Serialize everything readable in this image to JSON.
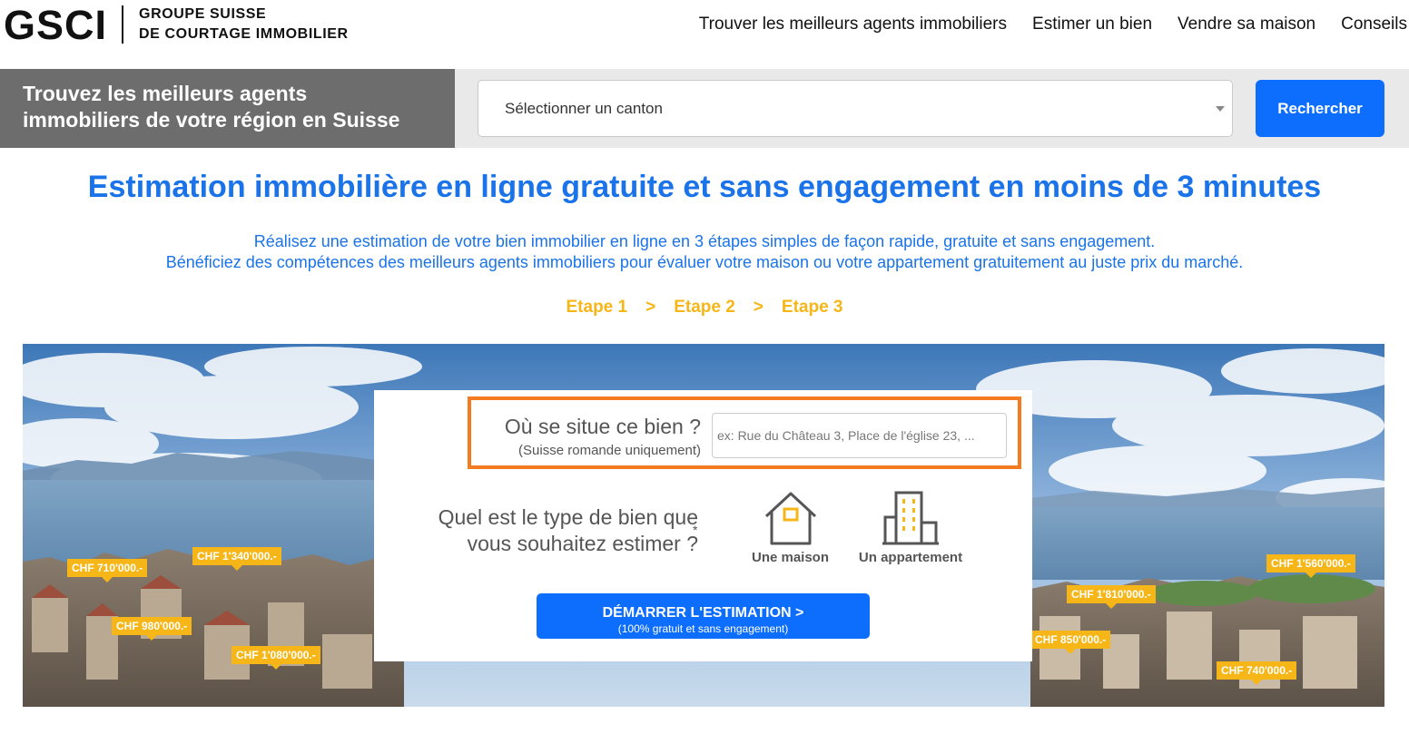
{
  "header": {
    "logo_mark": "GSCI",
    "logo_line1": "GROUPE SUISSE",
    "logo_line2": "DE COURTAGE IMMOBILIER",
    "nav": [
      "Trouver les meilleurs agents immobiliers",
      "Estimer un bien",
      "Vendre sa maison",
      "Conseils"
    ]
  },
  "search": {
    "title_line1": "Trouvez les meilleurs agents",
    "title_line2": "immobiliers de votre région en Suisse",
    "select_value": "Sélectionner un canton",
    "button_label": "Rechercher"
  },
  "intro": {
    "title": "Estimation immobilière en ligne gratuite et sans engagement en moins de 3 minutes",
    "line1": "Réalisez une estimation de votre bien immobilier en ligne en 3 étapes simples de façon rapide, gratuite et sans engagement.",
    "line2": "Bénéficiez des compétences des meilleurs agents immobiliers pour évaluer votre maison ou votre appartement gratuitement au juste prix du marché.",
    "steps": [
      "Etape 1",
      "Etape 2",
      "Etape 3"
    ],
    "step_separator": ">"
  },
  "hero": {
    "price_tags": [
      "CHF 710'000.-",
      "CHF 1'340'000.-",
      "CHF 980'000.-",
      "CHF 1'080'000.-",
      "CHF 1'560'000.-",
      "CHF 1'810'000.-",
      "CHF 850'000.-",
      "CHF 740'000.-"
    ]
  },
  "form": {
    "address_question": "Où se situe ce bien ?",
    "address_note": "(Suisse romande uniquement)",
    "address_placeholder": "ex: Rue du Château 3, Place de l'église 23, ...",
    "type_question_line1": "Quel est le type de bien que",
    "type_question_line2": "vous souhaitez estimer ?",
    "required_mark": "*",
    "option_house": "Une maison",
    "option_apartment": "Un appartement",
    "start_label": "DÉMARRER L'ESTIMATION >",
    "start_sub": "(100% gratuit et sans engagement)"
  },
  "colors": {
    "brand_blue": "#0d6efd",
    "title_blue": "#1a73e8",
    "accent_yellow": "#f6b618",
    "highlight_orange": "#f47b20",
    "band_gray": "#6d6d6d"
  }
}
